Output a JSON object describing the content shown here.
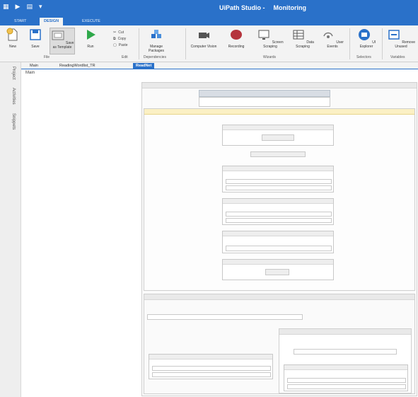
{
  "title_bar": {
    "app_name": "UiPath Studio -",
    "project_name": "Monitoring"
  },
  "ribbon_tabs": [
    "START",
    "DESIGN",
    "EXECUTE"
  ],
  "ribbon": {
    "new_label": "New",
    "save_label": "Save",
    "save_as_template_label": "Save as Template",
    "run_label": "Run",
    "cut_label": "Cut",
    "copy_label": "Copy",
    "paste_label": "Paste",
    "manage_packages_label": "Manage Packages",
    "computer_vision_label": "Computer Vision",
    "recording_label": "Recording",
    "screen_scraping_label": "Screen Scraping",
    "data_scraping_label": "Data Scraping",
    "user_events_label": "User Events",
    "ui_explorer_label": "UI Explorer",
    "remove_unused_label": "Remove Unused",
    "group_file": "File",
    "group_edit": "Edit",
    "group_dependencies": "Dependencies",
    "group_wizards": "Wizards",
    "group_selectors": "Selectors",
    "group_variables": "Variables"
  },
  "side_panels": [
    "Project",
    "Activities",
    "Snippets"
  ],
  "doc_tabs": [
    "Main",
    "ReadingWordlist_TR",
    "ReadNet"
  ],
  "breadcrumb": "Main",
  "colors": {
    "accent": "#2a71c9",
    "ribbon_bg": "#f3f3f3",
    "if_header": "#fbf0c4"
  }
}
